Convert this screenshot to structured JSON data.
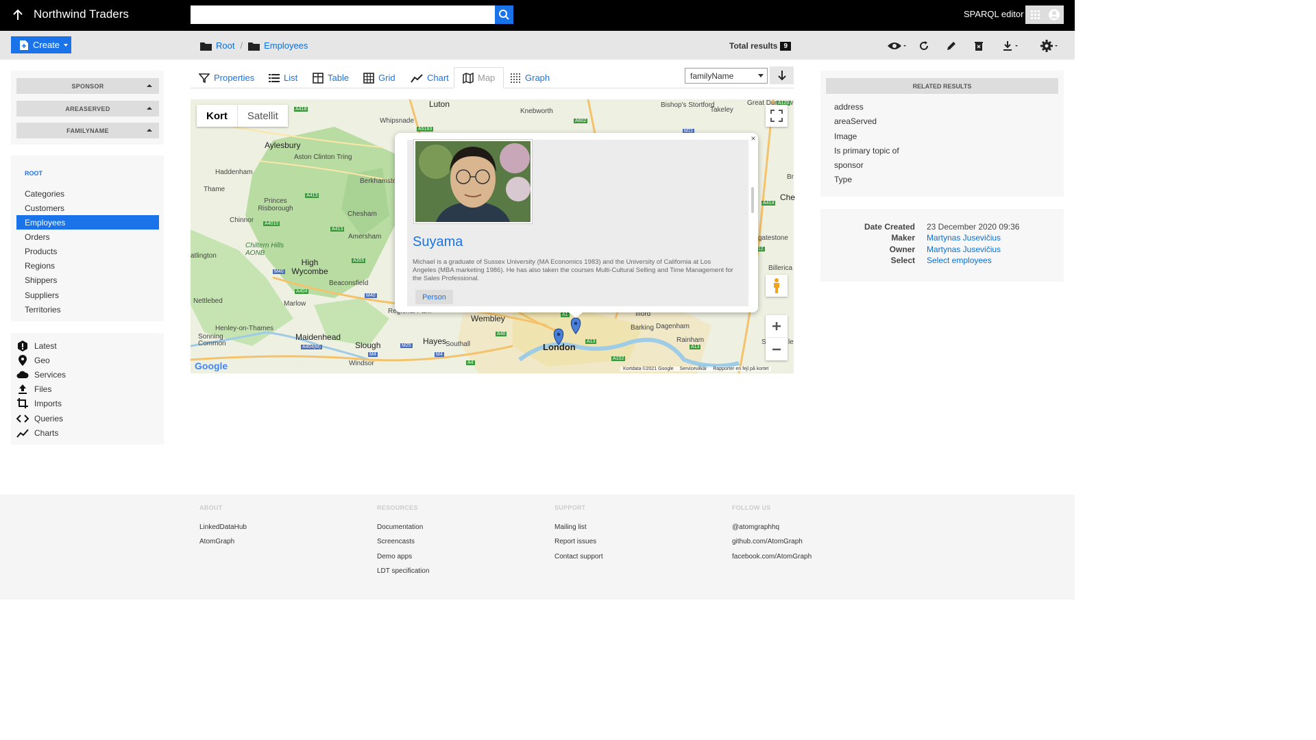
{
  "header": {
    "app_title": "Northwind Traders",
    "search_placeholder": "",
    "sparql_label": "SPARQL editor"
  },
  "toolbar": {
    "create_label": "Create",
    "breadcrumb": [
      {
        "label": "Root"
      },
      {
        "label": "Employees"
      }
    ],
    "total_label": "Total results",
    "total_count": "9"
  },
  "facets": [
    {
      "label": "SPONSOR"
    },
    {
      "label": "AREASERVED"
    },
    {
      "label": "FAMILYNAME"
    }
  ],
  "nav": {
    "root_label": "ROOT",
    "items": [
      {
        "label": "Categories"
      },
      {
        "label": "Customers"
      },
      {
        "label": "Employees",
        "active": true
      },
      {
        "label": "Orders"
      },
      {
        "label": "Products"
      },
      {
        "label": "Regions"
      },
      {
        "label": "Shippers"
      },
      {
        "label": "Suppliers"
      },
      {
        "label": "Territories"
      }
    ]
  },
  "tools": [
    {
      "label": "Latest",
      "icon": "alert-icon"
    },
    {
      "label": "Geo",
      "icon": "map-pin-icon"
    },
    {
      "label": "Services",
      "icon": "cloud-icon"
    },
    {
      "label": "Files",
      "icon": "upload-icon"
    },
    {
      "label": "Imports",
      "icon": "crop-icon"
    },
    {
      "label": "Queries",
      "icon": "code-icon"
    },
    {
      "label": "Charts",
      "icon": "line-chart-icon"
    }
  ],
  "tabs": [
    {
      "label": "Properties",
      "icon": "filter-icon"
    },
    {
      "label": "List",
      "icon": "list-icon"
    },
    {
      "label": "Table",
      "icon": "table-icon"
    },
    {
      "label": "Grid",
      "icon": "grid-icon"
    },
    {
      "label": "Chart",
      "icon": "chart-icon"
    },
    {
      "label": "Map",
      "icon": "map-icon",
      "active": true
    },
    {
      "label": "Graph",
      "icon": "graph-icon"
    }
  ],
  "sort": {
    "selected": "familyName"
  },
  "map": {
    "type_buttons": [
      "Kort",
      "Satellit"
    ],
    "places": [
      "Luton",
      "Knebworth",
      "Bishop's Stortford",
      "Takeley",
      "Great Dunmow",
      "Whipsnade",
      "Aylesbury",
      "Aston Clinton Tring",
      "Haddenham",
      "Berkhamste",
      "Thame",
      "Princes Risborough",
      "Chinnor",
      "Chesham",
      "Amersham",
      "Chiltern Hills AONB",
      "High Wycombe",
      "atlington",
      "Beaconsfield",
      "Nettlebed",
      "Marlow",
      "Regional Park",
      "Wembley",
      "Ilford",
      "Barking",
      "Dagenham",
      "Henley-on-Thames",
      "Maidenhead",
      "Slough",
      "Hayes",
      "Southall",
      "London",
      "Rainham",
      "Sonning Common",
      "Windsor",
      "Che",
      "gatestone",
      "Billerica",
      "Br",
      "St",
      "le"
    ],
    "roads": [
      "A418",
      "A5183",
      "A602",
      "M11",
      "A413",
      "A4010",
      "A413",
      "A355",
      "M40",
      "A404",
      "M40",
      "A40",
      "M25",
      "M4",
      "A4",
      "A404(M)",
      "M4",
      "A13",
      "A102",
      "A13",
      "A414",
      "A1",
      "A120",
      "12"
    ],
    "attribution": [
      "Kortdata ©2021 Google",
      "Servicevilkår",
      "Rapporter en fejl på kortet"
    ],
    "google_label": "Google"
  },
  "info_window": {
    "title": "Suyama",
    "description": "Michael is a graduate of Sussex University (MA Economics 1983) and the University of California at Los Angeles (MBA marketing 1986). He has also taken the courses Multi-Cultural Selling and Time Management for the Sales Professional.",
    "tag": "Person"
  },
  "related": {
    "title": "RELATED RESULTS",
    "items": [
      "address",
      "areaServed",
      "Image",
      "Is primary topic of",
      "sponsor",
      "Type"
    ]
  },
  "meta": [
    {
      "key": "Date Created",
      "value": "23 December 2020 09:36",
      "link": false
    },
    {
      "key": "Maker",
      "value": "Martynas Jusevičius",
      "link": true
    },
    {
      "key": "Owner",
      "value": "Martynas Jusevičius",
      "link": true
    },
    {
      "key": "Select",
      "value": "Select employees",
      "link": true
    }
  ],
  "footer": {
    "columns": [
      {
        "head": "ABOUT",
        "links": [
          "LinkedDataHub",
          "AtomGraph"
        ]
      },
      {
        "head": "RESOURCES",
        "links": [
          "Documentation",
          "Screencasts",
          "Demo apps",
          "LDT specification"
        ]
      },
      {
        "head": "SUPPORT",
        "links": [
          "Mailing list",
          "Report issues",
          "Contact support"
        ]
      },
      {
        "head": "FOLLOW US",
        "links": [
          "@atomgraphhq",
          "github.com/AtomGraph",
          "facebook.com/AtomGraph"
        ]
      }
    ]
  },
  "colors": {
    "accent": "#1a73e8",
    "topbar": "#000000",
    "toolbar": "#e6e6e6"
  }
}
